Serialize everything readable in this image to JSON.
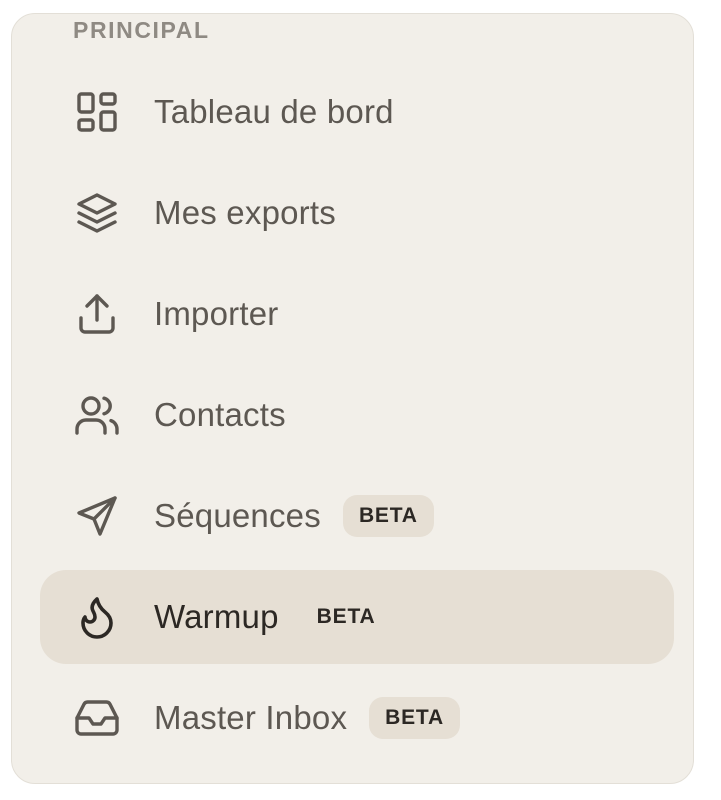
{
  "sidebar": {
    "section_label": "PRINCIPAL",
    "items": [
      {
        "label": "Tableau de bord",
        "icon": "dashboard-grid-icon",
        "badge": null,
        "active": false
      },
      {
        "label": "Mes exports",
        "icon": "layers-stack-icon",
        "badge": null,
        "active": false
      },
      {
        "label": "Importer",
        "icon": "upload-icon",
        "badge": null,
        "active": false
      },
      {
        "label": "Contacts",
        "icon": "users-icon",
        "badge": null,
        "active": false
      },
      {
        "label": "Séquences",
        "icon": "send-plane-icon",
        "badge": "BETA",
        "active": false
      },
      {
        "label": "Warmup",
        "icon": "flame-icon",
        "badge": "BETA",
        "active": true
      },
      {
        "label": "Master Inbox",
        "icon": "inbox-tray-icon",
        "badge": "BETA",
        "active": false
      }
    ]
  },
  "colors": {
    "panel_background": "#f2efe9",
    "active_background": "#e6dfd4",
    "badge_background": "#e6dfd4",
    "text": "#5d5852",
    "active_text": "#2c2824",
    "section_label": "#8f8a83"
  }
}
